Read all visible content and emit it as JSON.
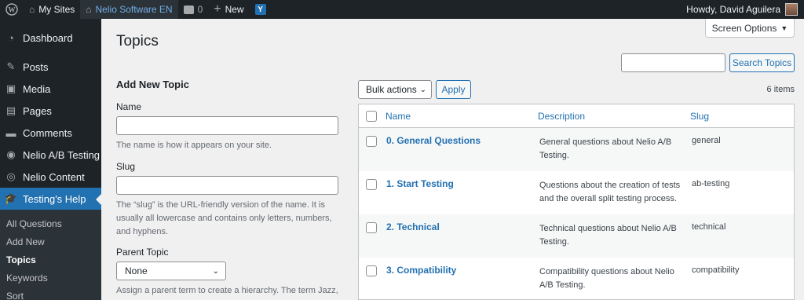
{
  "adminbar": {
    "my_sites": "My Sites",
    "site_name": "Nelio Software EN",
    "comments_count": "0",
    "new_label": "New",
    "yoast_label": "Y",
    "greeting": "Howdy, David Aguilera"
  },
  "sidebar": {
    "items": [
      {
        "label": "Dashboard",
        "icon": "dashboard-icon"
      },
      {
        "label": "Posts",
        "icon": "pin-icon"
      },
      {
        "label": "Media",
        "icon": "media-icon"
      },
      {
        "label": "Pages",
        "icon": "pages-icon"
      },
      {
        "label": "Comments",
        "icon": "comment-icon"
      },
      {
        "label": "Nelio A/B Testing",
        "icon": "nelio-ab-icon"
      },
      {
        "label": "Nelio Content",
        "icon": "nelio-content-icon"
      },
      {
        "label": "Testing's Help",
        "icon": "graduation-cap-icon"
      }
    ],
    "submenu": [
      "All Questions",
      "Add New",
      "Topics",
      "Keywords",
      "Sort"
    ]
  },
  "page": {
    "title": "Topics",
    "screen_options": "Screen Options",
    "search_button": "Search Topics"
  },
  "form": {
    "heading": "Add New Topic",
    "name_label": "Name",
    "name_desc": "The name is how it appears on your site.",
    "slug_label": "Slug",
    "slug_desc": "The “slug” is the URL-friendly version of the name. It is usually all lowercase and contains only letters, numbers, and hyphens.",
    "parent_label": "Parent Topic",
    "parent_value": "None",
    "parent_desc": "Assign a parent term to create a hierarchy. The term Jazz, for example, would be the parent of Bebop and Big Band."
  },
  "list": {
    "bulk_actions": "Bulk actions",
    "apply": "Apply",
    "count": "6 items",
    "columns": {
      "name": "Name",
      "description": "Description",
      "slug": "Slug"
    },
    "rows": [
      {
        "name": "0. General Questions",
        "description": "General questions about Nelio A/B Testing.",
        "slug": "general"
      },
      {
        "name": "1. Start Testing",
        "description": "Questions about the creation of tests and the overall split testing process.",
        "slug": "ab-testing"
      },
      {
        "name": "2. Technical",
        "description": "Technical questions about Nelio A/B Testing.",
        "slug": "technical"
      },
      {
        "name": "3. Compatibility",
        "description": "Compatibility questions about Nelio A/B Testing.",
        "slug": "compatibility"
      }
    ]
  },
  "colors": {
    "accent": "#2271b1",
    "adminbar": "#1d2327",
    "background": "#f0f0f1"
  }
}
